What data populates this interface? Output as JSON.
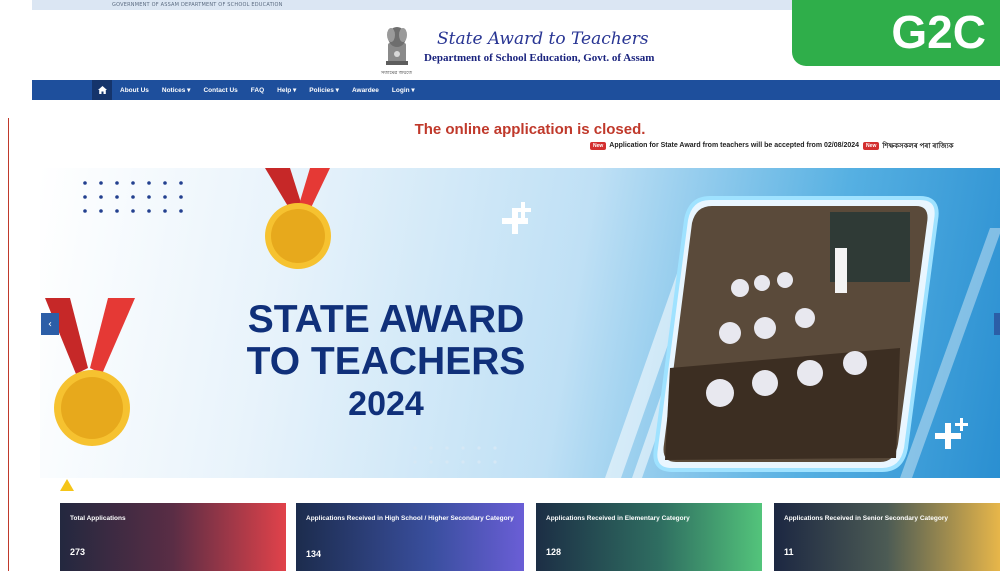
{
  "top_strip": {
    "text": "GOVERNMENT OF ASSAM     DEPARTMENT OF SCHOOL EDUCATION"
  },
  "header": {
    "title": "State Award to Teachers",
    "subtitle": "Department of School Education, Govt. of Assam",
    "emblem_caption": "সত্যমেৱ জয়তে"
  },
  "g2c_badge": "G2C",
  "navbar": {
    "items": [
      {
        "label": "About Us"
      },
      {
        "label": "Notices ▾"
      },
      {
        "label": "Contact Us"
      },
      {
        "label": "FAQ"
      },
      {
        "label": "Help ▾"
      },
      {
        "label": "Policies ▾"
      },
      {
        "label": "Awardee"
      },
      {
        "label": "Login ▾"
      }
    ]
  },
  "notice": {
    "closed_text": "The online application is closed.",
    "new_badge": "New",
    "ticker_text": "Application for State Award from teachers will be accepted from 02/08/2024",
    "ticker_text_2": "শিক্ষকসকলৰ পৰা ৰাজ্যিক"
  },
  "banner": {
    "line1": "STATE AWARD",
    "line2": "TO TEACHERS",
    "line3": "2024"
  },
  "stats": [
    {
      "label": "Total Applications",
      "value": "273"
    },
    {
      "label": "Applications Received in High School / Higher Secondary Category",
      "value": "134"
    },
    {
      "label": "Applications Received in Elementary Category",
      "value": "128"
    },
    {
      "label": "Applications Received in Senior Secondary Category",
      "value": "11"
    }
  ],
  "colors": {
    "navbar": "#1e4f9c",
    "g2c": "#2fae4a",
    "closed_text": "#c0392b",
    "banner_title": "#10307a"
  },
  "icons": [
    "home-icon",
    "chevron-left-icon",
    "chevron-right-icon",
    "medal-icon",
    "emblem-icon"
  ]
}
